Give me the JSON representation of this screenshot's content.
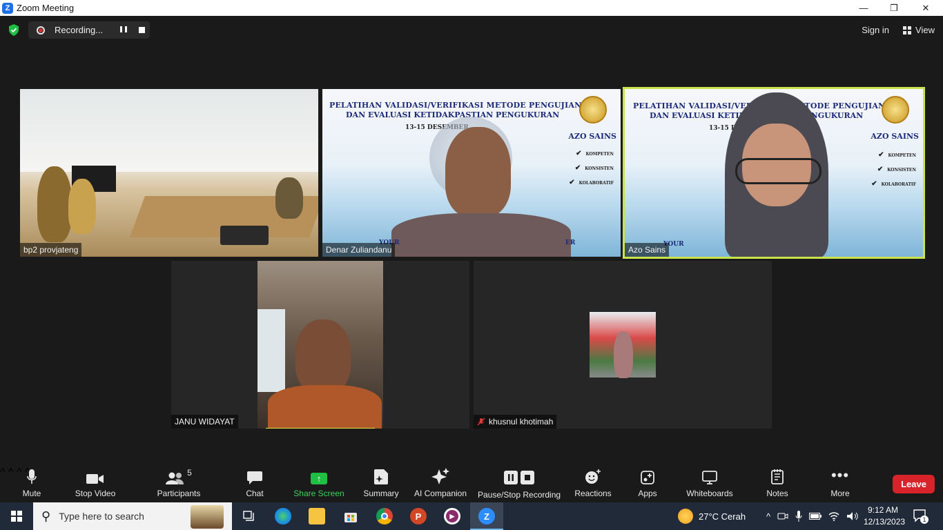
{
  "window": {
    "title": "Zoom Meeting",
    "controls": [
      "—",
      "❐",
      "✕"
    ]
  },
  "topbar": {
    "recording_label": "Recording...",
    "sign_in": "Sign in",
    "view": "View"
  },
  "tiles": [
    {
      "name": "bp2 provjateng"
    },
    {
      "name": "Denar Zuliandanu"
    },
    {
      "name": "Azo Sains"
    },
    {
      "name": "JANU WIDAYAT"
    },
    {
      "name": "khusnul khotimah"
    }
  ],
  "slide": {
    "title_line1": "PELATIHAN VALIDASI/VERIFIKASI METODE PENGUJIAN",
    "title_line2": "DAN EVALUASI KETIDAKPASTIAN PENGUKURAN",
    "date": "13-15 DESEMBER",
    "brand": "AZO SAINS",
    "values": [
      "KOMPETEN",
      "KONSISTEN",
      "KOLABORATIF"
    ],
    "footer_left": "YOUR",
    "footer_right": "ER"
  },
  "toolbar": {
    "mute": "Mute",
    "stop_video": "Stop Video",
    "participants": "Participants",
    "participants_count": "5",
    "chat": "Chat",
    "share_screen": "Share Screen",
    "summary": "Summary",
    "ai_companion": "AI Companion",
    "pause_stop_recording": "Pause/Stop Recording",
    "reactions": "Reactions",
    "apps": "Apps",
    "whiteboards": "Whiteboards",
    "notes": "Notes",
    "more": "More",
    "leave": "Leave"
  },
  "taskbar": {
    "search_placeholder": "Type here to search",
    "weather": "27°C  Cerah",
    "time": "9:12 AM",
    "date": "12/13/2023",
    "notification_count": "1"
  },
  "colors": {
    "accent_green": "#1fbf43",
    "leave_red": "#d9232b",
    "active_speaker": "#c9e34a",
    "zoom_blue": "#1f6fe6"
  }
}
